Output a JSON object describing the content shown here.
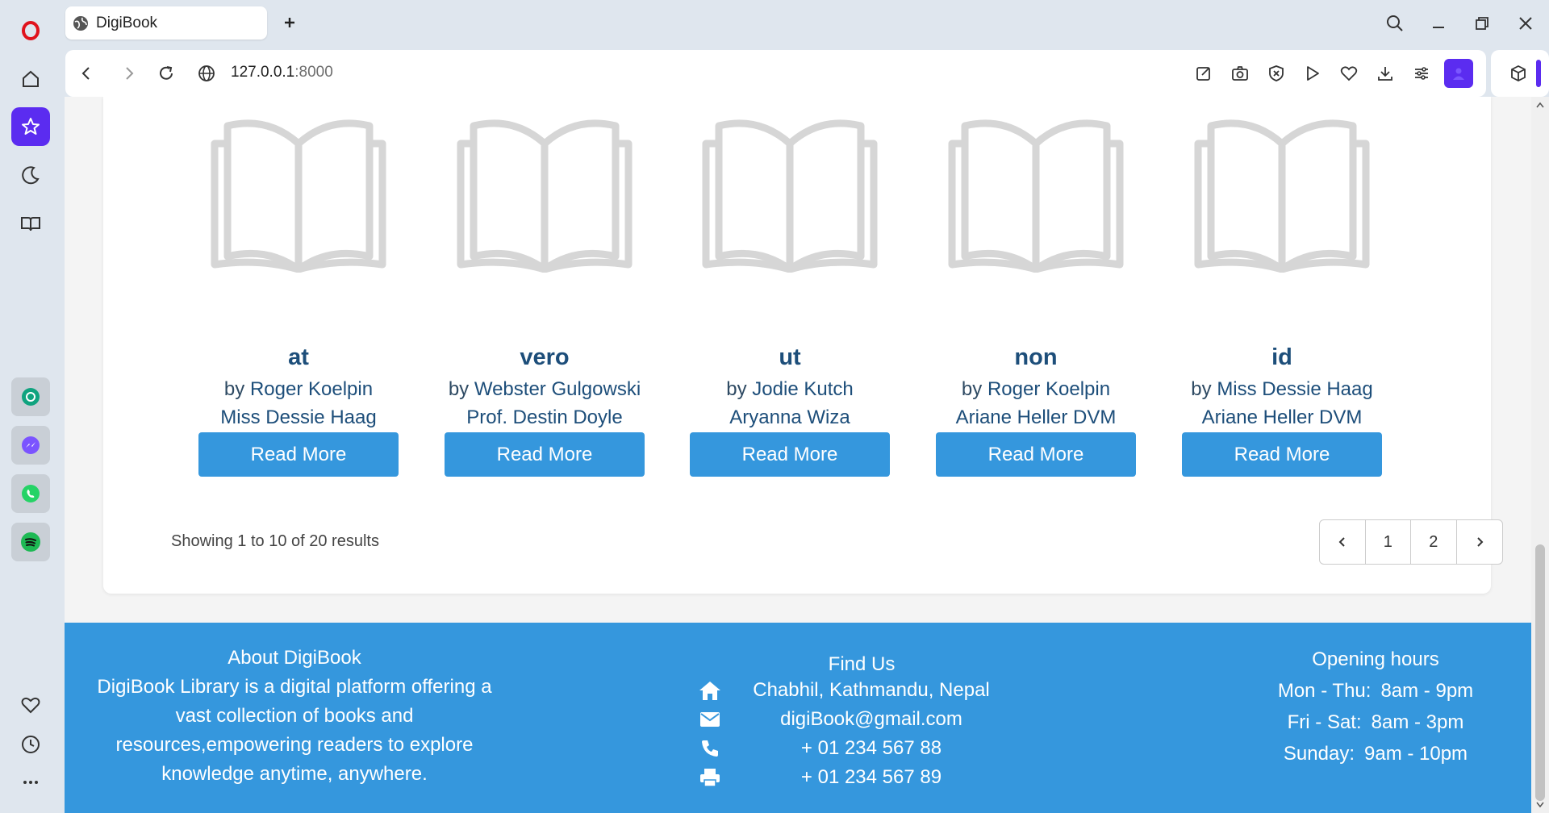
{
  "browser": {
    "tab_title": "DigiBook",
    "url_host": "127.0.0.1",
    "url_port": ":8000"
  },
  "books": [
    {
      "title": "at",
      "by_label": "by",
      "author": "Roger Koelpin",
      "author2": "Miss Dessie Haag",
      "button": "Read More"
    },
    {
      "title": "vero",
      "by_label": "by",
      "author": "Webster Gulgowski",
      "author2": "Prof. Destin Doyle",
      "button": "Read More"
    },
    {
      "title": "ut",
      "by_label": "by",
      "author": "Jodie Kutch",
      "author2": "Aryanna Wiza",
      "button": "Read More"
    },
    {
      "title": "non",
      "by_label": "by",
      "author": "Roger Koelpin",
      "author2": "Ariane Heller DVM",
      "button": "Read More"
    },
    {
      "title": "id",
      "by_label": "by",
      "author": "Miss Dessie Haag",
      "author2": "Ariane Heller DVM",
      "button": "Read More"
    }
  ],
  "pagination": {
    "summary": "Showing 1 to 10 of 20 results",
    "pages": [
      "1",
      "2"
    ]
  },
  "footer": {
    "about_title": "About DigiBook",
    "about_text": "DigiBook Library is a digital platform offering a vast collection of books and resources,empowering readers to explore knowledge anytime, anywhere.",
    "find_title": "Find Us",
    "address": "Chabhil, Kathmandu, Nepal",
    "email": "digiBook@gmail.com",
    "phone": "+ 01 234 567 88",
    "fax": "+ 01 234 567 89",
    "hours_title": "Opening hours",
    "hours": [
      {
        "days": "Mon - Thu:",
        "time": "8am - 9pm"
      },
      {
        "days": "Fri - Sat:",
        "time": "8am - 3pm"
      },
      {
        "days": "Sunday:",
        "time": "9am - 10pm"
      }
    ]
  },
  "colors": {
    "accent": "#3597dd",
    "heading": "#1d4e7a",
    "opera_purple": "#5b2cf0"
  }
}
